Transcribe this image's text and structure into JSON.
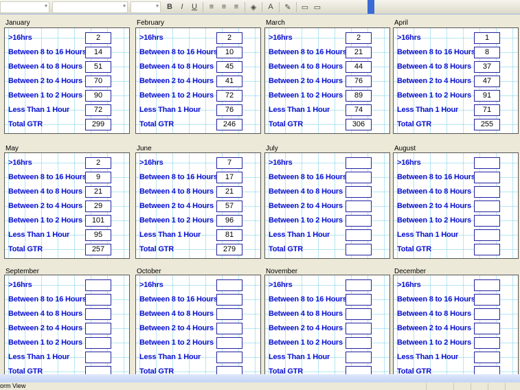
{
  "toolbar": {
    "buttons": [
      "B",
      "I",
      "U",
      "≡",
      "≡",
      "≡",
      "◈",
      "A",
      "✎",
      "▭",
      "▭"
    ]
  },
  "row_labels": [
    ">16hrs",
    "Between 8 to 16 Hours",
    "Between 4 to 8 Hours",
    "Between 2 to 4 Hours",
    "Between 1 to 2 Hours",
    "Less Than 1 Hour",
    "Total GTR"
  ],
  "months": [
    {
      "name": "January",
      "values": [
        "2",
        "14",
        "51",
        "70",
        "90",
        "72",
        "299"
      ]
    },
    {
      "name": "February",
      "values": [
        "2",
        "10",
        "45",
        "41",
        "72",
        "76",
        "246"
      ]
    },
    {
      "name": "March",
      "values": [
        "2",
        "21",
        "44",
        "76",
        "89",
        "74",
        "306"
      ]
    },
    {
      "name": "April",
      "values": [
        "1",
        "8",
        "37",
        "47",
        "91",
        "71",
        "255"
      ]
    },
    {
      "name": "May",
      "values": [
        "2",
        "9",
        "21",
        "29",
        "101",
        "95",
        "257"
      ]
    },
    {
      "name": "June",
      "values": [
        "7",
        "17",
        "21",
        "57",
        "96",
        "81",
        "279"
      ]
    },
    {
      "name": "July",
      "values": [
        "",
        "",
        "",
        "",
        "",
        "",
        ""
      ]
    },
    {
      "name": "August",
      "values": [
        "",
        "",
        "",
        "",
        "",
        "",
        ""
      ]
    },
    {
      "name": "September",
      "values": [
        "",
        "",
        "",
        "",
        "",
        "",
        ""
      ]
    },
    {
      "name": "October",
      "values": [
        "",
        "",
        "",
        "",
        "",
        "",
        ""
      ]
    },
    {
      "name": "November",
      "values": [
        "",
        "",
        "",
        "",
        "",
        "",
        ""
      ]
    },
    {
      "name": "December",
      "values": [
        "",
        "",
        "",
        "",
        "",
        "",
        ""
      ]
    }
  ],
  "status": {
    "text": "orm View"
  }
}
